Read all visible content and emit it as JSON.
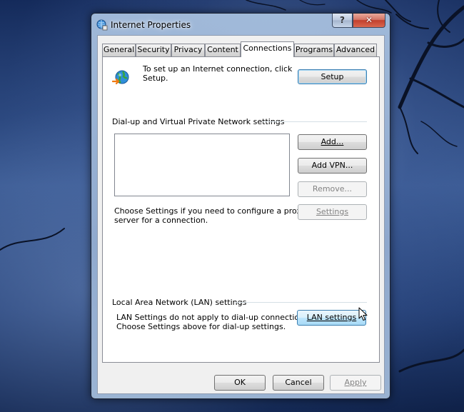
{
  "window": {
    "title": "Internet Properties",
    "help_label": "?",
    "close_label": "✕"
  },
  "tabs": [
    {
      "label": "General"
    },
    {
      "label": "Security"
    },
    {
      "label": "Privacy"
    },
    {
      "label": "Content"
    },
    {
      "label": "Connections"
    },
    {
      "label": "Programs"
    },
    {
      "label": "Advanced"
    }
  ],
  "active_tab": "Connections",
  "setup": {
    "icon": "globe-connection-icon",
    "text_line1": "To set up an Internet connection, click",
    "text_line2": "Setup.",
    "button": "Setup"
  },
  "dialup": {
    "group_label": "Dial-up and Virtual Private Network settings",
    "list_items": [],
    "add_button": "Add...",
    "add_vpn_button": "Add VPN...",
    "remove_button": "Remove...",
    "settings_button": "Settings",
    "hint_line1": "Choose Settings if you need to configure a proxy",
    "hint_line2": "server for a connection."
  },
  "lan": {
    "group_label": "Local Area Network (LAN) settings",
    "text_line1": "LAN Settings do not apply to dial-up connections.",
    "text_line2": "Choose Settings above for dial-up settings.",
    "button": "LAN settings"
  },
  "footer": {
    "ok": "OK",
    "cancel": "Cancel",
    "apply": "Apply"
  }
}
